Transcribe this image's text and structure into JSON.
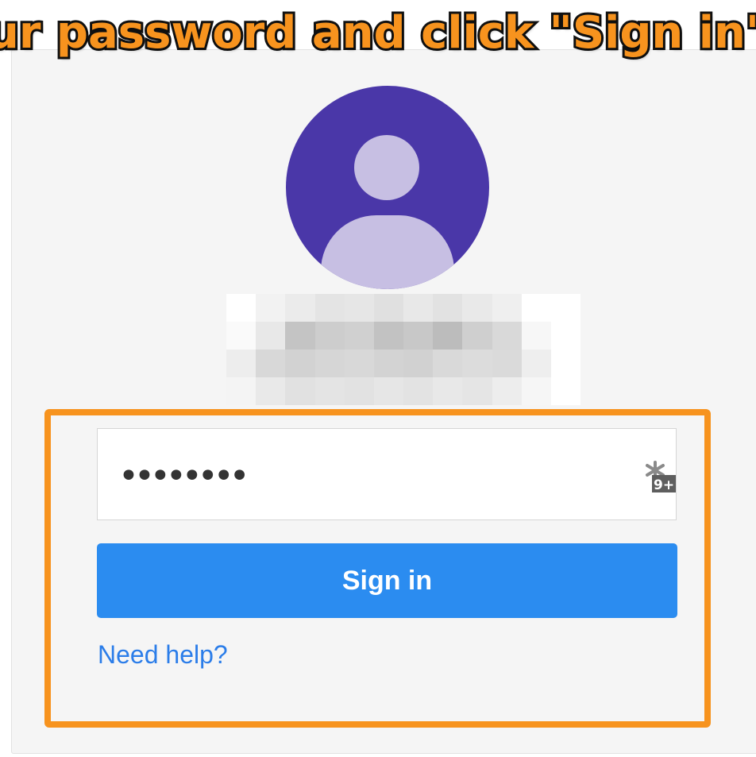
{
  "annotation": {
    "banner_text": "ur password and click \"Sign in\"",
    "banner_color": "#f7931e",
    "highlight_color": "#f7931e"
  },
  "account": {
    "avatar_icon": "default-user-avatar-icon",
    "avatar_bg_color": "#4a37a8",
    "email_state": "pixelated"
  },
  "login_form": {
    "password_value": "••••••••",
    "keychain_icon": "password-manager-key-icon",
    "keychain_badge": "9+",
    "signin_label": "Sign in",
    "signin_color": "#2b8cf0",
    "help_link": "Need help?",
    "link_color": "#2b7de9"
  }
}
